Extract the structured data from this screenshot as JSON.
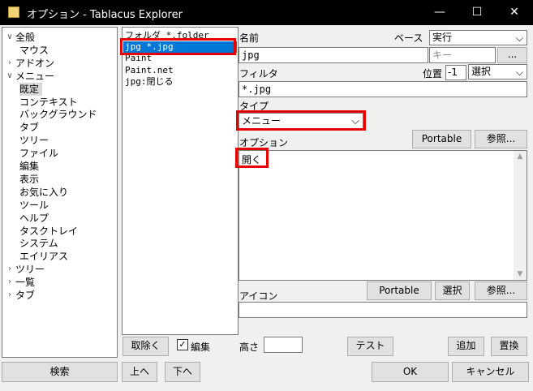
{
  "window": {
    "title": "オプション - Tablacus Explorer",
    "controls": {
      "minimize": "—",
      "maximize": "☐",
      "close": "✕"
    }
  },
  "tree": {
    "items": [
      {
        "label": "全般",
        "arrow": "∨"
      },
      {
        "label": "マウス",
        "arrow": ""
      },
      {
        "label": "アドオン",
        "arrow": "›"
      },
      {
        "label": "メニュー",
        "arrow": "∨"
      },
      {
        "label": "既定",
        "arrow": "",
        "selected": true
      },
      {
        "label": "コンテキスト",
        "arrow": ""
      },
      {
        "label": "バックグラウンド",
        "arrow": ""
      },
      {
        "label": "タブ",
        "arrow": ""
      },
      {
        "label": "ツリー",
        "arrow": ""
      },
      {
        "label": "ファイル",
        "arrow": ""
      },
      {
        "label": "編集",
        "arrow": ""
      },
      {
        "label": "表示",
        "arrow": ""
      },
      {
        "label": "お気に入り",
        "arrow": ""
      },
      {
        "label": "ツール",
        "arrow": ""
      },
      {
        "label": "ヘルプ",
        "arrow": ""
      },
      {
        "label": "タスクトレイ",
        "arrow": ""
      },
      {
        "label": "システム",
        "arrow": ""
      },
      {
        "label": "エイリアス",
        "arrow": ""
      },
      {
        "label": "ツリー",
        "arrow": "›"
      },
      {
        "label": "一覧",
        "arrow": "›"
      },
      {
        "label": "タブ",
        "arrow": "›"
      }
    ]
  },
  "list": {
    "items": [
      {
        "label": "フォルダ *.folder"
      },
      {
        "label": "jpg *.jpg",
        "selected": true
      },
      {
        "label": "Paint"
      },
      {
        "label": "Paint.net"
      },
      {
        "label": "jpg:閉じる"
      }
    ]
  },
  "form": {
    "name_label": "名前",
    "base_label": "ベース",
    "base_value": "実行",
    "name_value": "jpg",
    "key_placeholder": "キー",
    "ellipsis_button": "...",
    "filter_label": "フィルタ",
    "position_label": "位置",
    "position_value": "-1",
    "position_select": "選択",
    "filter_value": "*.jpg",
    "type_label": "タイプ",
    "type_value": "メニュー",
    "option_label": "オプション",
    "portable_button": "Portable",
    "browse_button": "参照...",
    "option_value": "開く",
    "icon_label": "アイコン",
    "icon_portable_button": "Portable",
    "icon_select_button": "選択",
    "icon_browse_button": "参照...",
    "height_label": "高さ",
    "test_button": "テスト",
    "add_button": "追加",
    "replace_button": "置換"
  },
  "list_controls": {
    "remove_button": "取除く",
    "edit_checkbox_label": "編集",
    "edit_checked": true,
    "up_button": "上へ",
    "down_button": "下へ"
  },
  "footer": {
    "search_button": "検索",
    "ok_button": "OK",
    "cancel_button": "キャンセル"
  },
  "colors": {
    "titlebar": "#000000",
    "selection": "#0078d7",
    "highlight_box": "#e60000"
  }
}
